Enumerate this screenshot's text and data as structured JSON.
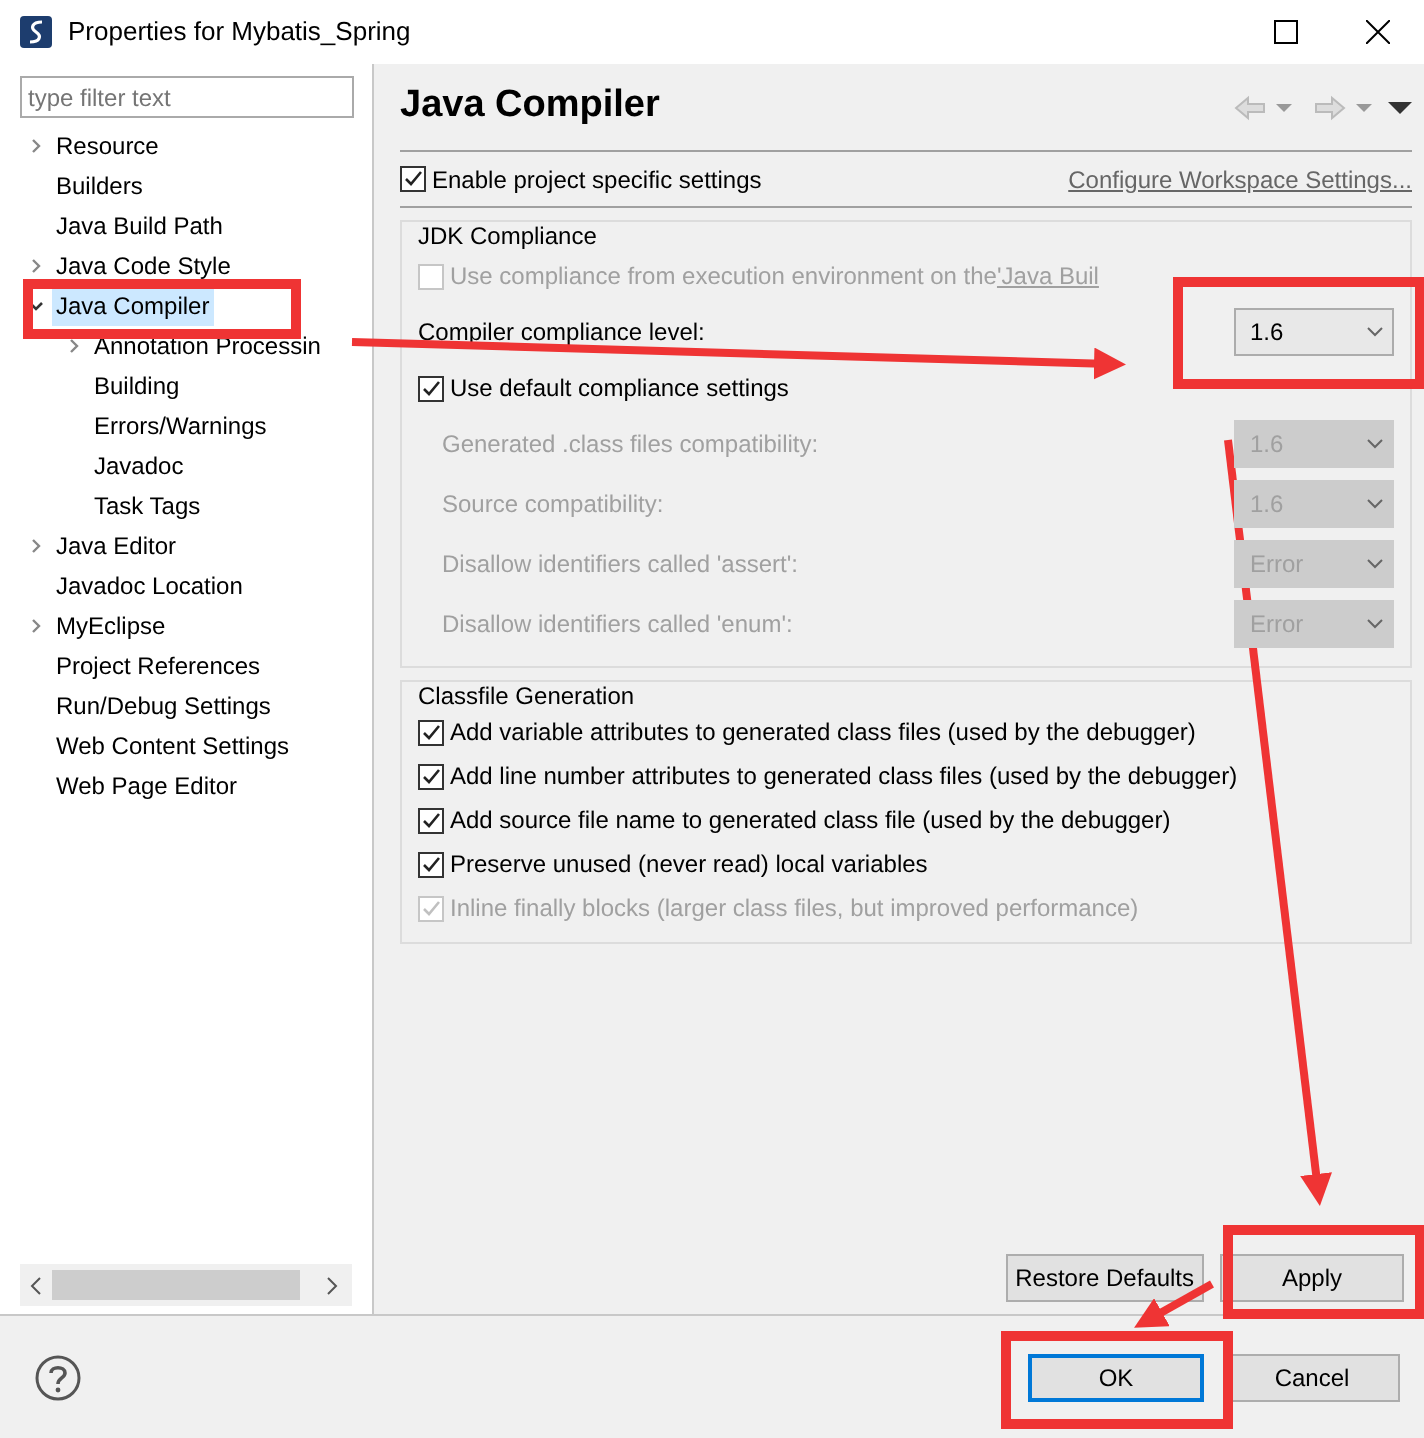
{
  "window": {
    "title": "Properties for Mybatis_Spring"
  },
  "filter": {
    "placeholder": "type filter text"
  },
  "tree": [
    {
      "label": "Resource",
      "expanded": false,
      "selected": false
    },
    {
      "label": "Builders",
      "selected": false
    },
    {
      "label": "Java Build Path",
      "selected": false
    },
    {
      "label": "Java Code Style",
      "expanded": false,
      "selected": false
    },
    {
      "label": "Java Compiler",
      "expanded": true,
      "selected": true,
      "children": [
        {
          "label": "Annotation Processin",
          "expanded": false,
          "selected": false
        },
        {
          "label": "Building",
          "selected": false
        },
        {
          "label": "Errors/Warnings",
          "selected": false
        },
        {
          "label": "Javadoc",
          "selected": false
        },
        {
          "label": "Task Tags",
          "selected": false
        }
      ]
    },
    {
      "label": "Java Editor",
      "expanded": false,
      "selected": false
    },
    {
      "label": "Javadoc Location",
      "selected": false
    },
    {
      "label": "MyEclipse",
      "expanded": false,
      "selected": false
    },
    {
      "label": "Project References",
      "selected": false
    },
    {
      "label": "Run/Debug Settings",
      "selected": false
    },
    {
      "label": "Web Content Settings",
      "selected": false
    },
    {
      "label": "Web Page Editor",
      "selected": false
    }
  ],
  "page": {
    "title": "Java Compiler"
  },
  "enable_project_settings": {
    "label": "Enable project specific settings",
    "checked": true
  },
  "configure_link": "Configure Workspace Settings...",
  "jdk_compliance": {
    "title": "JDK Compliance",
    "use_execution_env": {
      "label": "Use compliance from execution environment on the ",
      "link": "'Java Buil",
      "checked": false,
      "disabled": true
    },
    "compliance_level": {
      "label": "Compiler compliance level:",
      "value": "1.6",
      "disabled": false
    },
    "use_default": {
      "label": "Use default compliance settings",
      "checked": true
    },
    "settings": [
      {
        "label": "Generated .class files compatibility:",
        "value": "1.6",
        "disabled": true
      },
      {
        "label": "Source compatibility:",
        "value": "1.6",
        "disabled": true
      },
      {
        "label": "Disallow identifiers called 'assert':",
        "value": "Error",
        "disabled": true
      },
      {
        "label": "Disallow identifiers called 'enum':",
        "value": "Error",
        "disabled": true
      }
    ]
  },
  "classfile_generation": {
    "title": "Classfile Generation",
    "options": [
      {
        "label": "Add variable attributes to generated class files (used by the debugger)",
        "checked": true,
        "disabled": false
      },
      {
        "label": "Add line number attributes to generated class files (used by the debugger)",
        "checked": true,
        "disabled": false
      },
      {
        "label": "Add source file name to generated class file (used by the debugger)",
        "checked": true,
        "disabled": false
      },
      {
        "label": "Preserve unused (never read) local variables",
        "checked": true,
        "disabled": false
      },
      {
        "label": "Inline finally blocks (larger class files, but improved performance)",
        "checked": true,
        "disabled": true
      }
    ]
  },
  "page_buttons": [
    {
      "label": "Restore Defaults"
    },
    {
      "label": "Apply"
    }
  ],
  "dialog_buttons": [
    {
      "label": "OK",
      "default": true
    },
    {
      "label": "Cancel",
      "default": false
    }
  ]
}
